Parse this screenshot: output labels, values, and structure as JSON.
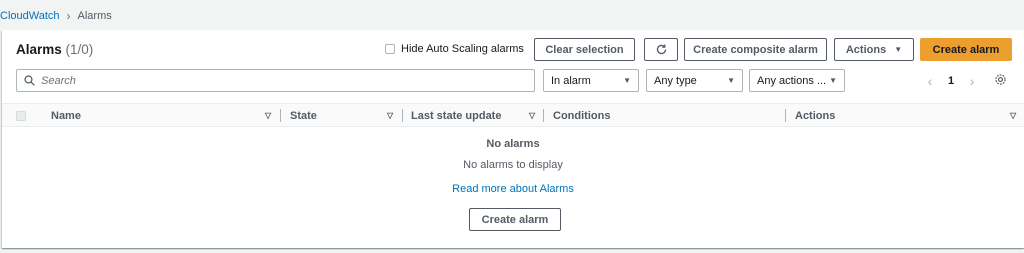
{
  "breadcrumb": {
    "root": "CloudWatch",
    "current": "Alarms"
  },
  "header": {
    "title": "Alarms",
    "count": "(1/0)",
    "hide_autoscaling_label": "Hide Auto Scaling alarms",
    "clear_selection": "Clear selection",
    "create_composite": "Create composite alarm",
    "actions": "Actions",
    "create_alarm": "Create alarm"
  },
  "filters": {
    "search_placeholder": "Search",
    "state": "In alarm",
    "type": "Any type",
    "actions": "Any actions ..."
  },
  "pagination": {
    "page": "1"
  },
  "table": {
    "columns": [
      "Name",
      "State",
      "Last state update",
      "Conditions",
      "Actions"
    ]
  },
  "empty": {
    "title": "No alarms",
    "subtitle": "No alarms to display",
    "link": "Read more about Alarms",
    "button": "Create alarm"
  },
  "colors": {
    "link": "#0073bb",
    "primary": "#ec9f2f",
    "background": "#f2f3f3"
  },
  "icons": [
    "chevron-right-icon",
    "refresh-icon",
    "caret-down-icon",
    "search-icon",
    "chevron-left-icon",
    "settings-gear-icon"
  ]
}
